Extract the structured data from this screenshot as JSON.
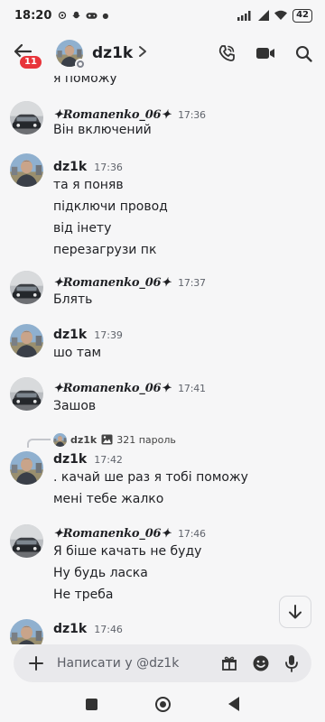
{
  "status_bar": {
    "time": "18:20",
    "battery": "42"
  },
  "header": {
    "name": "dz1k",
    "unread_badge": "11"
  },
  "messages": {
    "top_partial": "я поможу",
    "m1": {
      "author": "✦Romanenko_06✦",
      "time": "17:36",
      "lines": [
        "Він включений"
      ]
    },
    "m2": {
      "author": "dz1k",
      "time": "17:36",
      "lines": [
        "та я поняв",
        "підключи провод",
        "від інету",
        "перезагрузи пк"
      ]
    },
    "m3": {
      "author": "✦Romanenko_06✦",
      "time": "17:37",
      "lines": [
        "Блять"
      ]
    },
    "m4": {
      "author": "dz1k",
      "time": "17:39",
      "lines": [
        "шо там"
      ]
    },
    "m5": {
      "author": "✦Romanenko_06✦",
      "time": "17:41",
      "lines": [
        "Зашов"
      ]
    },
    "reply": {
      "author": "dz1k",
      "text": "321 пароль"
    },
    "m6": {
      "author": "dz1k",
      "time": "17:42",
      "lines": [
        ". качай ше раз я тобі поможу",
        "мені тебе жалко"
      ]
    },
    "m7": {
      "author": "✦Romanenko_06✦",
      "time": "17:46",
      "lines": [
        "Я біше качать не буду",
        "Ну будь ласка",
        "Не треба"
      ]
    },
    "m8": {
      "author": "dz1k",
      "time": "17:46"
    }
  },
  "composer": {
    "placeholder": "Написати у @dz1k"
  },
  "icons": {
    "back": "arrow-left-icon",
    "call": "phone-icon",
    "video": "video-camera-icon",
    "search": "search-icon",
    "add": "plus-icon",
    "gift": "gift-icon",
    "emoji": "emoji-icon",
    "mic": "microphone-icon",
    "scroll": "arrow-down-icon"
  },
  "colors": {
    "badge": "#e8343a",
    "background": "#f6f6f7",
    "composer": "#e9e9ec"
  }
}
